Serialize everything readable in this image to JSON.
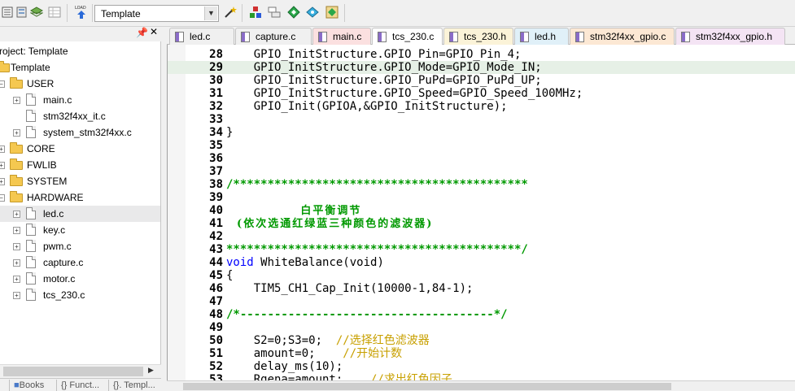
{
  "toolbar": {
    "target_value": "Template",
    "icons": [
      "project-icon",
      "batch-icon",
      "layers-icon",
      "grid-icon",
      "load-icon",
      "magic-wand-icon",
      "manage-components-icon",
      "pack-installer-icon",
      "select-device-icon",
      "options-icon",
      "run-icon"
    ]
  },
  "project": {
    "title": "roject: Template",
    "root": "Template",
    "groups": [
      {
        "name": "USER",
        "files": [
          "main.c",
          "stm32f4xx_it.c",
          "system_stm32f4xx.c"
        ]
      },
      {
        "name": "CORE"
      },
      {
        "name": "FWLIB"
      },
      {
        "name": "SYSTEM"
      },
      {
        "name": "HARDWARE",
        "files": [
          "led.c",
          "key.c",
          "pwm.c",
          "capture.c",
          "motor.c",
          "tcs_230.c"
        ]
      }
    ],
    "selected_file": "led.c"
  },
  "bottom_tabs": [
    "Books",
    "{} Funct...",
    "{}. Templ..."
  ],
  "file_tabs": [
    {
      "label": "led.c",
      "color": "#f0f0f0"
    },
    {
      "label": "capture.c",
      "color": "#f0f0f0"
    },
    {
      "label": "main.c",
      "color": "#fbe0e0"
    },
    {
      "label": "tcs_230.c",
      "color": "#ffffff"
    },
    {
      "label": "tcs_230.h",
      "color": "#fbf3d8"
    },
    {
      "label": "led.h",
      "color": "#e0f0f8"
    },
    {
      "label": "stm32f4xx_gpio.c",
      "color": "#fce8d4"
    },
    {
      "label": "stm32f4xx_gpio.h",
      "color": "#f4e4f4"
    }
  ],
  "editor": {
    "lines": [
      {
        "num": "28",
        "code": "    GPIO_InitStructure.GPIO_Pin=GPIO_Pin_4;"
      },
      {
        "num": "29",
        "code": "    GPIO_InitStructure.GPIO_Mode=GPIO_Mode_IN;",
        "current": true
      },
      {
        "num": "30",
        "code": "    GPIO_InitStructure.GPIO_PuPd=GPIO_PuPd_UP;"
      },
      {
        "num": "31",
        "code": "    GPIO_InitStructure.GPIO_Speed=GPIO_Speed_100MHz;"
      },
      {
        "num": "32",
        "code": "    GPIO_Init(GPIOA,&GPIO_InitStructure);"
      },
      {
        "num": "33",
        "code": ""
      },
      {
        "num": "34",
        "code": "}"
      },
      {
        "num": "35",
        "code": ""
      },
      {
        "num": "36",
        "code": ""
      },
      {
        "num": "37",
        "code": ""
      },
      {
        "num": "38",
        "code": "/*******************************************",
        "kind": "comment"
      },
      {
        "num": "39",
        "code": ""
      },
      {
        "num": "40",
        "code": "              白平衡调节",
        "kind": "comment-zh"
      },
      {
        "num": "41",
        "code": "  (依次选通红绿蓝三种颜色的滤波器)",
        "kind": "comment-zh"
      },
      {
        "num": "42",
        "code": ""
      },
      {
        "num": "43",
        "code": "*******************************************/",
        "kind": "comment"
      },
      {
        "num": "44",
        "code": "WhiteBalance(void)",
        "kw": "void"
      },
      {
        "num": "45",
        "code": "{"
      },
      {
        "num": "46",
        "code": "    TIM5_CH1_Cap_Init(10000-1,84-1);"
      },
      {
        "num": "47",
        "code": ""
      },
      {
        "num": "48",
        "code": "/*-------------------------------------*/",
        "kind": "comment"
      },
      {
        "num": "49",
        "code": ""
      },
      {
        "num": "50",
        "code": "    S2=0;S3=0;",
        "tail": "  //选择红色滤波器"
      },
      {
        "num": "51",
        "code": "    amount=0;",
        "tail": "    //开始计数"
      },
      {
        "num": "52",
        "code": "    delay_ms(10);"
      },
      {
        "num": "53",
        "code": "    Rgena=amount;",
        "tail": "    //求出红色因子"
      }
    ]
  }
}
